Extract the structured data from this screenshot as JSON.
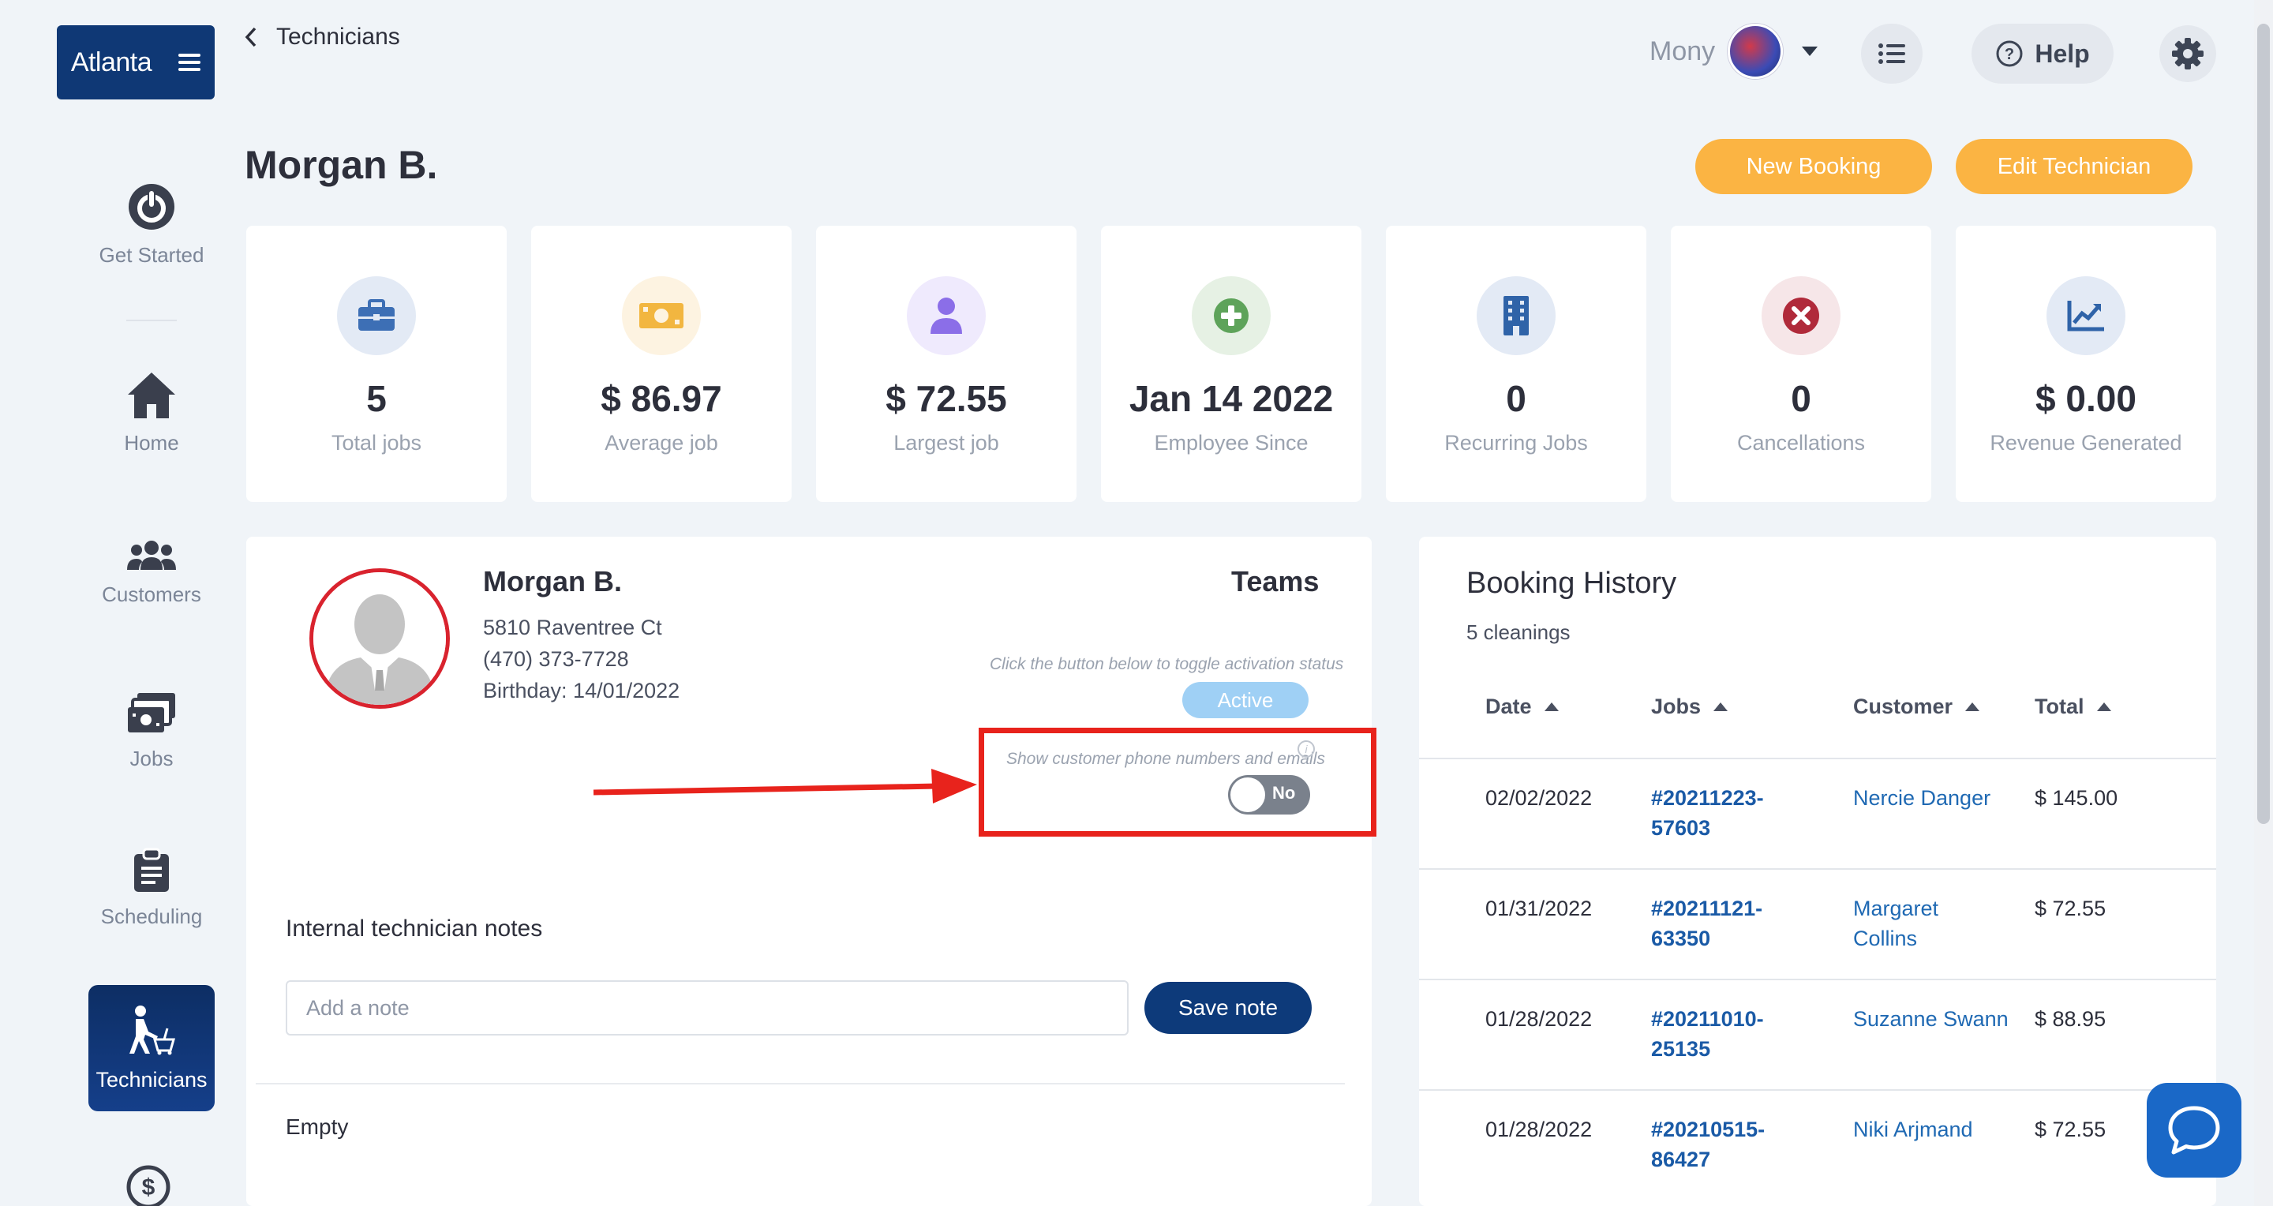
{
  "sidebar": {
    "brand": "Atlanta",
    "items": [
      {
        "label": "Get Started",
        "icon": "power-icon"
      },
      {
        "label": "Home",
        "icon": "home-icon"
      },
      {
        "label": "Customers",
        "icon": "users-icon"
      },
      {
        "label": "Jobs",
        "icon": "jobs-icon"
      },
      {
        "label": "Scheduling",
        "icon": "clipboard-icon"
      },
      {
        "label": "Technicians",
        "icon": "technician-icon",
        "active": true
      }
    ]
  },
  "header": {
    "back_label": "Technicians",
    "user_name": "Mony",
    "help_label": "Help"
  },
  "page": {
    "title": "Morgan B.",
    "new_booking": "New Booking",
    "edit_technician": "Edit Technician"
  },
  "stats": [
    {
      "value": "5",
      "label": "Total jobs",
      "icon": "briefcase-icon",
      "color": "#3d6fb5"
    },
    {
      "value": "$ 86.97",
      "label": "Average job",
      "icon": "money-icon",
      "color": "#f2b640"
    },
    {
      "value": "$ 72.55",
      "label": "Largest job",
      "icon": "user-icon",
      "color": "#8b6ee8"
    },
    {
      "value": "Jan 14 2022",
      "label": "Employee Since",
      "icon": "plus-circle-icon",
      "color": "#5ea35a"
    },
    {
      "value": "0",
      "label": "Recurring Jobs",
      "icon": "building-icon",
      "color": "#2f63a8"
    },
    {
      "value": "0",
      "label": "Cancellations",
      "icon": "x-circle-icon",
      "color": "#b02a3a"
    },
    {
      "value": "$ 0.00",
      "label": "Revenue Generated",
      "icon": "chart-icon",
      "color": "#2f63a8"
    }
  ],
  "profile": {
    "name": "Morgan B.",
    "address": "5810 Raventree Ct",
    "phone": "(470) 373-7728",
    "birthday": "Birthday: 14/01/2022",
    "teams_title": "Teams",
    "activation_hint": "Click the button below to toggle activation status",
    "status": "Active",
    "contact_hint": "Show customer phone numbers and emails",
    "contact_toggle": "No",
    "notes_title": "Internal technician notes",
    "note_placeholder": "Add a note",
    "save_note": "Save note",
    "notes_empty": "Empty"
  },
  "booking_history": {
    "title": "Booking History",
    "subtitle": "5 cleanings",
    "columns": [
      "Date",
      "Jobs",
      "Customer",
      "Total"
    ],
    "rows": [
      {
        "date": "02/02/2022",
        "job_1": "#20211223-",
        "job_2": "57603",
        "customer_1": "Nercie Danger",
        "customer_2": "",
        "total": "$ 145.00"
      },
      {
        "date": "01/31/2022",
        "job_1": "#20211121-",
        "job_2": "63350",
        "customer_1": "Margaret",
        "customer_2": "Collins",
        "total": "$ 72.55"
      },
      {
        "date": "01/28/2022",
        "job_1": "#20211010-",
        "job_2": "25135",
        "customer_1": "Suzanne Swann",
        "customer_2": "",
        "total": "$ 88.95"
      },
      {
        "date": "01/28/2022",
        "job_1": "#20210515-",
        "job_2": "86427",
        "customer_1": "Niki Arjmand",
        "customer_2": "",
        "total": "$ 72.55"
      }
    ]
  },
  "colors": {
    "brand_navy": "#0f3875",
    "accent_yellow": "#fbb443",
    "highlight_red": "#e8231c",
    "link_blue": "#1a5aa6"
  }
}
